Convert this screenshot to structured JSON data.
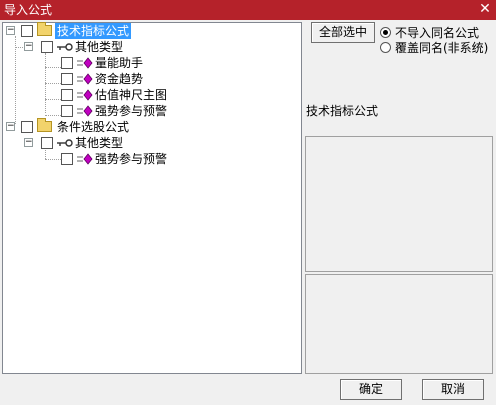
{
  "window": {
    "title": "导入公式",
    "close_glyph": "✕"
  },
  "tree": {
    "groups": [
      {
        "label": "技术指标公式",
        "expander": "−",
        "category": {
          "label": "其他类型",
          "expander": "−",
          "items": [
            "量能助手",
            "资金趋势",
            "估值神尺主图",
            "强势参与预警"
          ]
        }
      },
      {
        "label": "条件选股公式",
        "expander": "−",
        "category": {
          "label": "其他类型",
          "expander": "−",
          "items": [
            "强势参与预警"
          ]
        }
      }
    ]
  },
  "right_panel": {
    "select_all_label": "全部选中",
    "options": [
      {
        "label": "不导入同名公式",
        "selected": true
      },
      {
        "label": "覆盖同名(非系统)",
        "selected": false
      }
    ],
    "info_title": "技术指标公式"
  },
  "footer": {
    "ok_label": "确定",
    "cancel_label": "取消"
  },
  "colors": {
    "titlebar": "#b5222a",
    "selection": "#3399ff",
    "formula_icon": "#c000c0"
  }
}
